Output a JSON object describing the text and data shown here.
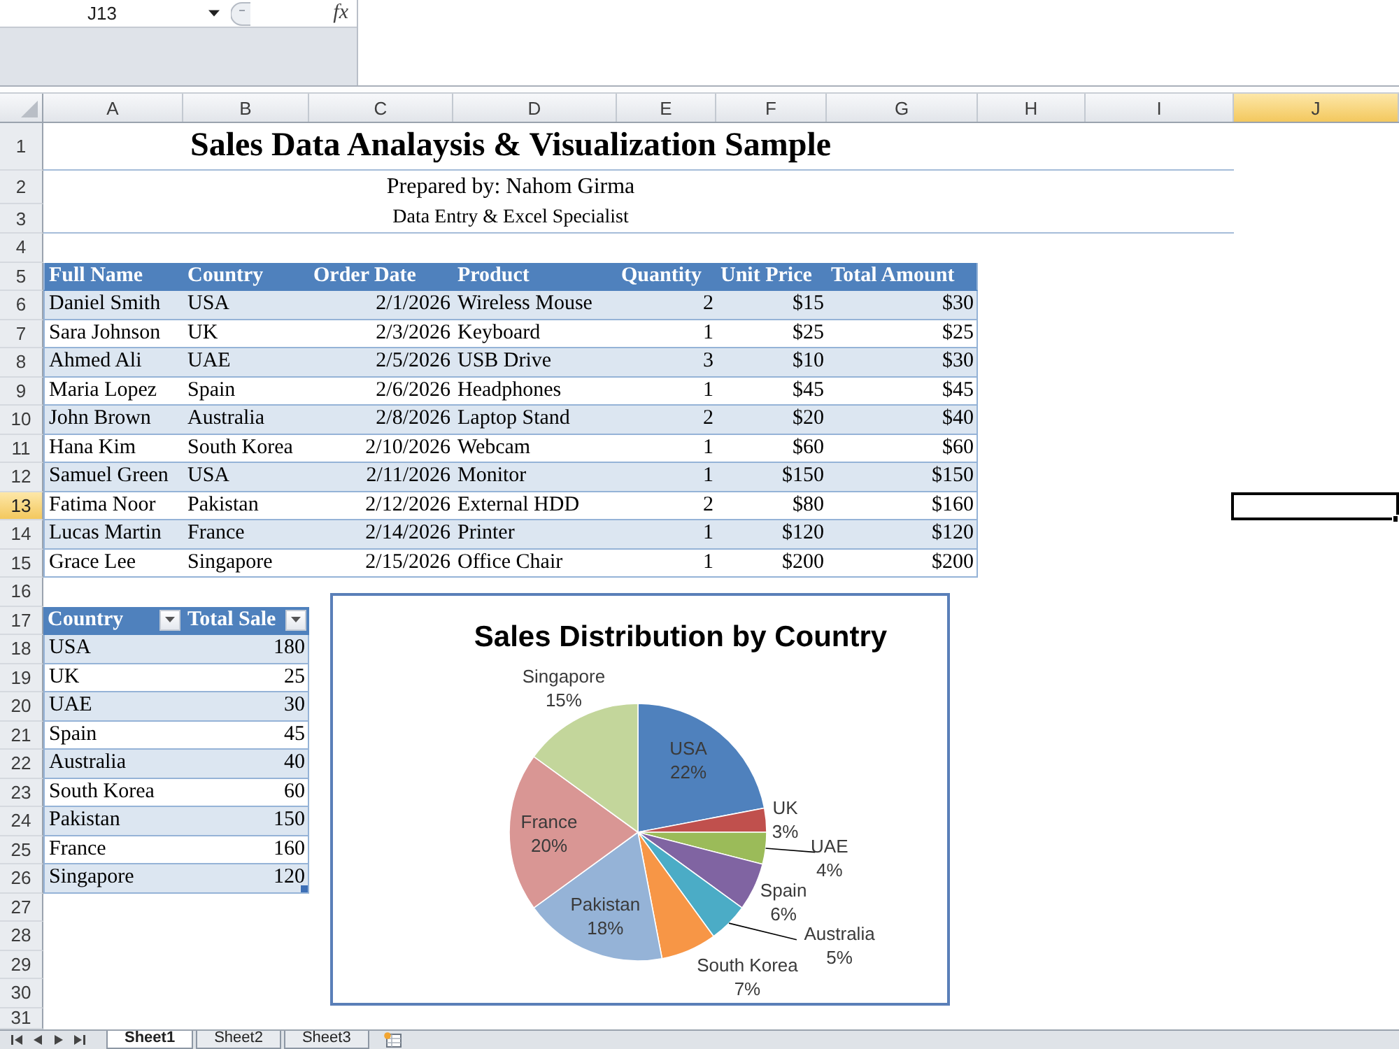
{
  "name_box": {
    "value": "J13"
  },
  "formula_bar": {
    "function_button": "fx"
  },
  "columns": [
    {
      "label": "A",
      "selected": false
    },
    {
      "label": "B",
      "selected": false
    },
    {
      "label": "C",
      "selected": false
    },
    {
      "label": "D",
      "selected": false
    },
    {
      "label": "E",
      "selected": false
    },
    {
      "label": "F",
      "selected": false
    },
    {
      "label": "G",
      "selected": false
    },
    {
      "label": "H",
      "selected": false
    },
    {
      "label": "I",
      "selected": false
    },
    {
      "label": "J",
      "selected": true
    }
  ],
  "rows": [
    {
      "label": "1",
      "selected": false
    },
    {
      "label": "2",
      "selected": false
    },
    {
      "label": "3",
      "selected": false
    },
    {
      "label": "4",
      "selected": false
    },
    {
      "label": "5",
      "selected": false
    },
    {
      "label": "6",
      "selected": false
    },
    {
      "label": "7",
      "selected": false
    },
    {
      "label": "8",
      "selected": false
    },
    {
      "label": "9",
      "selected": false
    },
    {
      "label": "10",
      "selected": false
    },
    {
      "label": "11",
      "selected": false
    },
    {
      "label": "12",
      "selected": false
    },
    {
      "label": "13",
      "selected": true
    },
    {
      "label": "14",
      "selected": false
    },
    {
      "label": "15",
      "selected": false
    },
    {
      "label": "16",
      "selected": false
    },
    {
      "label": "17",
      "selected": false
    },
    {
      "label": "18",
      "selected": false
    },
    {
      "label": "19",
      "selected": false
    },
    {
      "label": "20",
      "selected": false
    },
    {
      "label": "21",
      "selected": false
    },
    {
      "label": "22",
      "selected": false
    },
    {
      "label": "23",
      "selected": false
    },
    {
      "label": "24",
      "selected": false
    },
    {
      "label": "25",
      "selected": false
    },
    {
      "label": "26",
      "selected": false
    },
    {
      "label": "27",
      "selected": false
    },
    {
      "label": "28",
      "selected": false
    },
    {
      "label": "29",
      "selected": false
    },
    {
      "label": "30",
      "selected": false
    },
    {
      "label": "31",
      "selected": false
    }
  ],
  "title_block": {
    "title": "Sales Data Analaysis & Visualization Sample",
    "prepared_by": "Prepared by: Nahom Girma",
    "role": "Data Entry & Excel Specialist"
  },
  "sales_table": {
    "columns": [
      {
        "label": "Full Name",
        "kind": "text"
      },
      {
        "label": "Country",
        "kind": "text"
      },
      {
        "label": "Order Date",
        "kind": "number"
      },
      {
        "label": "Product",
        "kind": "text"
      },
      {
        "label": "Quantity",
        "kind": "number"
      },
      {
        "label": "Unit Price",
        "kind": "number"
      },
      {
        "label": "Total Amount",
        "kind": "number"
      }
    ],
    "rows": [
      [
        "Daniel Smith",
        "USA",
        "2/1/2026",
        "Wireless Mouse",
        "2",
        "$15",
        "$30"
      ],
      [
        "Sara Johnson",
        "UK",
        "2/3/2026",
        "Keyboard",
        "1",
        "$25",
        "$25"
      ],
      [
        "Ahmed Ali",
        "UAE",
        "2/5/2026",
        "USB Drive",
        "3",
        "$10",
        "$30"
      ],
      [
        "Maria Lopez",
        "Spain",
        "2/6/2026",
        "Headphones",
        "1",
        "$45",
        "$45"
      ],
      [
        "John Brown",
        "Australia",
        "2/8/2026",
        "Laptop Stand",
        "2",
        "$20",
        "$40"
      ],
      [
        "Hana Kim",
        "South Korea",
        "2/10/2026",
        "Webcam",
        "1",
        "$60",
        "$60"
      ],
      [
        "Samuel Green",
        "USA",
        "2/11/2026",
        "Monitor",
        "1",
        "$150",
        "$150"
      ],
      [
        "Fatima Noor",
        "Pakistan",
        "2/12/2026",
        "External HDD",
        "2",
        "$80",
        "$160"
      ],
      [
        "Lucas Martin",
        "France",
        "2/14/2026",
        "Printer",
        "1",
        "$120",
        "$120"
      ],
      [
        "Grace Lee",
        "Singapore",
        "2/15/2026",
        "Office Chair",
        "1",
        "$200",
        "$200"
      ]
    ]
  },
  "pivot_table": {
    "columns": [
      {
        "label": "Country",
        "kind": "text"
      },
      {
        "label": "Total Sale",
        "kind": "number"
      }
    ],
    "rows": [
      [
        "USA",
        "180"
      ],
      [
        "UK",
        "25"
      ],
      [
        "UAE",
        "30"
      ],
      [
        "Spain",
        "45"
      ],
      [
        "Australia",
        "40"
      ],
      [
        "South Korea",
        "60"
      ],
      [
        "Pakistan",
        "150"
      ],
      [
        "France",
        "160"
      ],
      [
        "Singapore",
        "120"
      ]
    ]
  },
  "chart": {
    "chart_data": [
      {
        "type": "pie",
        "title": "Sales Distribution by Country",
        "categories": [
          "USA",
          "UK",
          "UAE",
          "Spain",
          "Australia",
          "South Korea",
          "Pakistan",
          "France",
          "Singapore"
        ],
        "values": [
          22,
          3,
          4,
          6,
          5,
          7,
          18,
          20,
          15
        ],
        "colors": [
          "#4f81bd",
          "#c0504d",
          "#9bbb59",
          "#8064a2",
          "#4bacc6",
          "#f79646",
          "#95b3d7",
          "#d99694",
          "#c3d69b"
        ],
        "value_labels": [
          "22%",
          "3%",
          "4%",
          "6%",
          "5%",
          "7%",
          "18%",
          "20%",
          "15%"
        ]
      }
    ]
  },
  "sheet_tabs": [
    {
      "label": "Sheet1",
      "selected": true
    },
    {
      "label": "Sheet2",
      "selected": false
    },
    {
      "label": "Sheet3",
      "selected": false
    }
  ]
}
